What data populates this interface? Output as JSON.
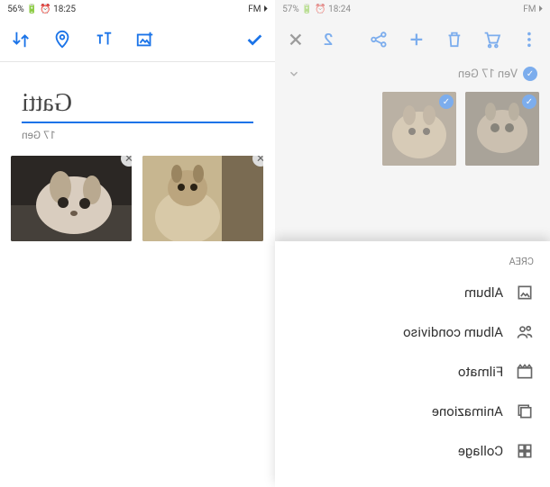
{
  "left": {
    "status": {
      "left": "FM ⏵",
      "right": "56% 🔋 ⏰ 18:25"
    },
    "title": "Gatti",
    "subdate": "17 Gen",
    "thumbs": [
      "cat1",
      "cat2"
    ]
  },
  "right": {
    "status": {
      "left": "FM ⏵",
      "right": "57% 🔋 ⏰ 18:24"
    },
    "count": "2",
    "date": "Ven 17 Gen",
    "sheet": {
      "header": "CREA",
      "items": [
        {
          "label": "Album",
          "icon": "album"
        },
        {
          "label": "Album condiviso",
          "icon": "shared-album"
        },
        {
          "label": "Filmato",
          "icon": "movie"
        },
        {
          "label": "Animazione",
          "icon": "animation"
        },
        {
          "label": "Collage",
          "icon": "collage"
        }
      ]
    }
  }
}
